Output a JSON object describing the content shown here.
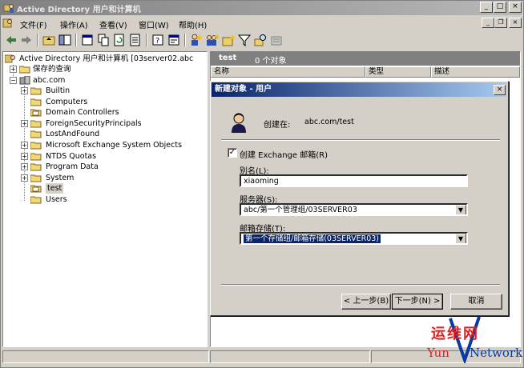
{
  "window": {
    "title": "Active Directory 用户和计算机",
    "minimize": "_",
    "maximize": "□",
    "close": "×"
  },
  "menu": [
    {
      "label": "文件(F)"
    },
    {
      "label": "操作(A)"
    },
    {
      "label": "查看(V)"
    },
    {
      "label": "窗口(W)"
    },
    {
      "label": "帮助(H)"
    }
  ],
  "mdi": {
    "minimize": "_",
    "restore": "❐",
    "close": "×"
  },
  "tree": {
    "root": "Active Directory 用户和计算机 [03server02.abc",
    "saved_queries": "保存的查询",
    "domain": "abc.com",
    "items": [
      {
        "label": "Builtin"
      },
      {
        "label": "Computers"
      },
      {
        "label": "Domain Controllers"
      },
      {
        "label": "ForeignSecurityPrincipals"
      },
      {
        "label": "LostAndFound"
      },
      {
        "label": "Microsoft Exchange System Objects"
      },
      {
        "label": "NTDS Quotas"
      },
      {
        "label": "Program Data"
      },
      {
        "label": "System"
      },
      {
        "label": "test"
      },
      {
        "label": "Users"
      }
    ]
  },
  "right": {
    "title": "test",
    "count": "0 个对象",
    "columns": [
      {
        "label": "名称"
      },
      {
        "label": "类型"
      },
      {
        "label": "描述"
      }
    ]
  },
  "dialog": {
    "title": "新建对象 - 用户",
    "close": "×",
    "create_in_label": "创建在:",
    "create_in_value": "abc.com/test",
    "checkbox_label": "创建 Exchange 邮箱(R)",
    "checkbox_mark": "✓",
    "alias_label": "别名(L):",
    "alias_value": "xiaoming",
    "server_label": "服务器(S):",
    "server_value": "abc/第一个管理组/03SERVER03",
    "store_label": "邮箱存储(T):",
    "store_value": "第一个存储组/邮箱存储(03SERVER03)",
    "back": "< 上一步(B)",
    "next": "下一步(N) >",
    "cancel": "取消"
  },
  "watermark": {
    "cn": "运维网",
    "en_left": "Yun",
    "en_right": "Network"
  }
}
